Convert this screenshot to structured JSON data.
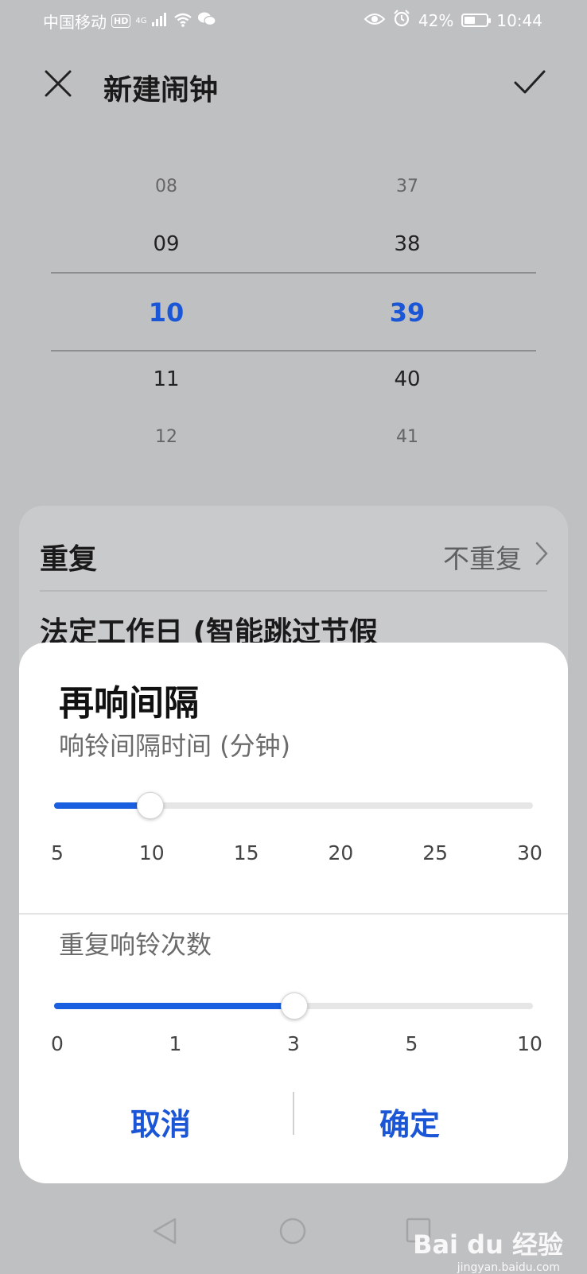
{
  "status_bar": {
    "carrier": "中国移动",
    "hd": "HD",
    "network": "4G",
    "battery": "42%",
    "time": "10:44"
  },
  "header": {
    "title": "新建闹钟"
  },
  "picker": {
    "hours": [
      "08",
      "09",
      "10",
      "11",
      "12"
    ],
    "minutes": [
      "37",
      "38",
      "39",
      "40",
      "41"
    ],
    "selected_hour": "10",
    "selected_minute": "39"
  },
  "settings": {
    "repeat_label": "重复",
    "repeat_value": "不重复",
    "workday_label": "法定工作日 (智能跳过节假"
  },
  "dialog": {
    "title": "再响间隔",
    "interval": {
      "label": "响铃间隔时间 (分钟)",
      "ticks": [
        "5",
        "10",
        "15",
        "20",
        "25",
        "30"
      ],
      "value": 10,
      "fraction": 0.2
    },
    "count": {
      "label": "重复响铃次数",
      "ticks": [
        "0",
        "1",
        "3",
        "5",
        "10"
      ],
      "value": 3,
      "fraction": 0.5
    },
    "cancel_label": "取消",
    "confirm_label": "确定"
  },
  "watermark": {
    "logo": "Bai du 经验",
    "url": "jingyan.baidu.com"
  },
  "colors": {
    "accent": "#1a56d6",
    "slider_fill": "#1a5fe0",
    "background": "#bfc0c2"
  }
}
